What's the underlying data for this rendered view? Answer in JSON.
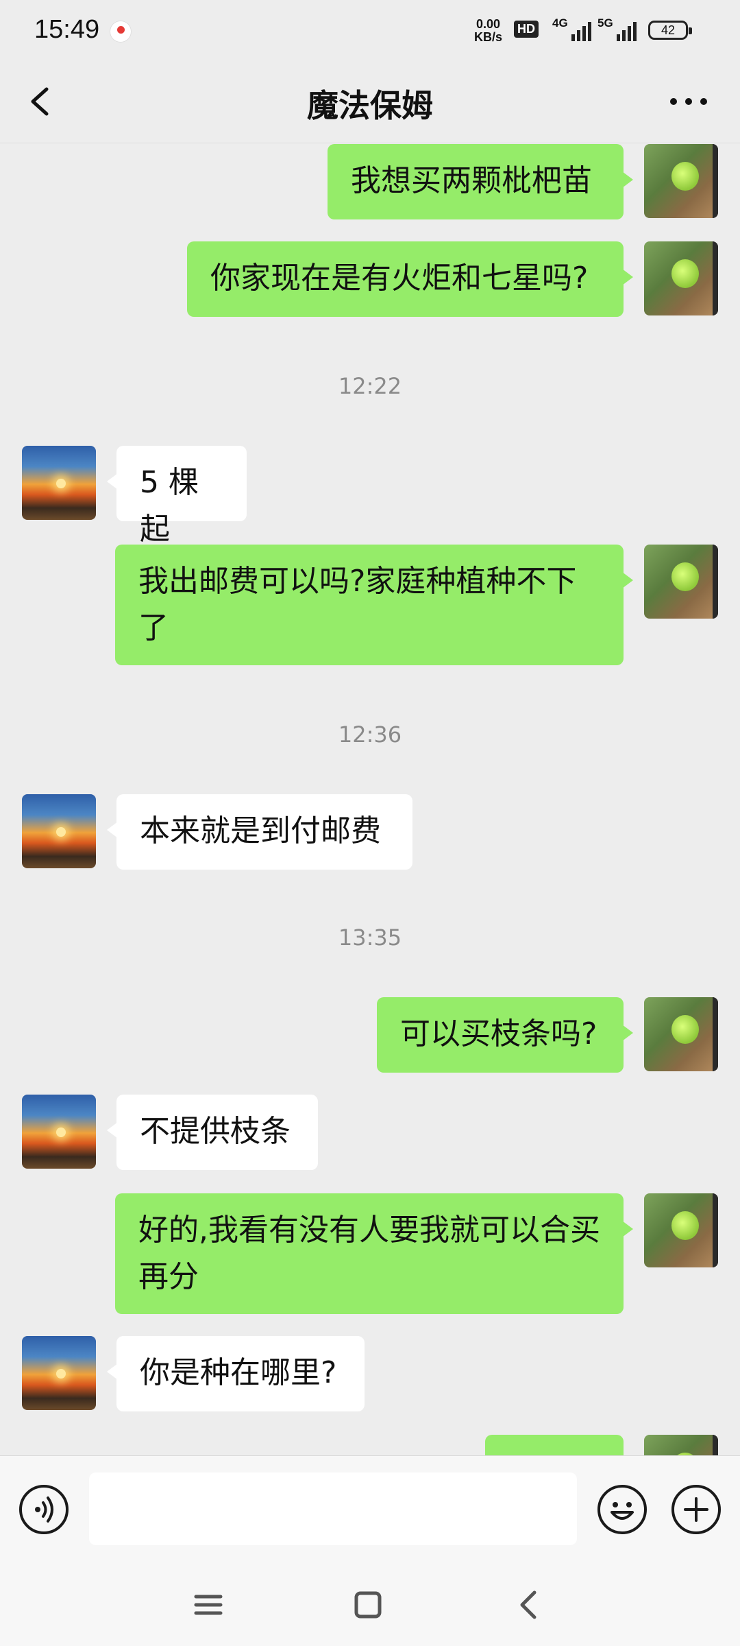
{
  "status_bar": {
    "time": "15:49",
    "net_speed_top": "0.00",
    "net_speed_bottom": "KB/s",
    "hd_label": "HD",
    "sim1_label": "4G",
    "sim2_label": "5G",
    "battery": "42"
  },
  "header": {
    "title": "魔法保姆"
  },
  "messages": [
    {
      "side": "me",
      "text": "我想买两颗枇杷苗"
    },
    {
      "side": "me",
      "text": "你家现在是有火炬和七星吗?"
    },
    {
      "timestamp": "12:22"
    },
    {
      "side": "them",
      "text": "5 棵起"
    },
    {
      "side": "me",
      "text": "我出邮费可以吗?家庭种植种不下了"
    },
    {
      "timestamp": "12:36"
    },
    {
      "side": "them",
      "text": "本来就是到付邮费"
    },
    {
      "timestamp": "13:35"
    },
    {
      "side": "me",
      "text": "可以买枝条吗?"
    },
    {
      "side": "them",
      "text": "不提供枝条"
    },
    {
      "side": "me",
      "text": "好的,我看有没有人要我就可以合买再分"
    },
    {
      "side": "them",
      "text": "你是种在哪里?"
    }
  ],
  "input_bar": {
    "input_value": "",
    "voice_icon": "voice-icon",
    "emoji_icon": "emoji-icon",
    "plus_icon": "plus-icon"
  },
  "nav_bar": {
    "menu_icon": "menu-icon",
    "home_icon": "home-icon",
    "back_icon": "back-icon"
  },
  "colors": {
    "background": "#EDEDED",
    "my_bubble": "#95EC69",
    "their_bubble": "#FFFFFF",
    "timestamp_text": "#8A8A8A"
  }
}
